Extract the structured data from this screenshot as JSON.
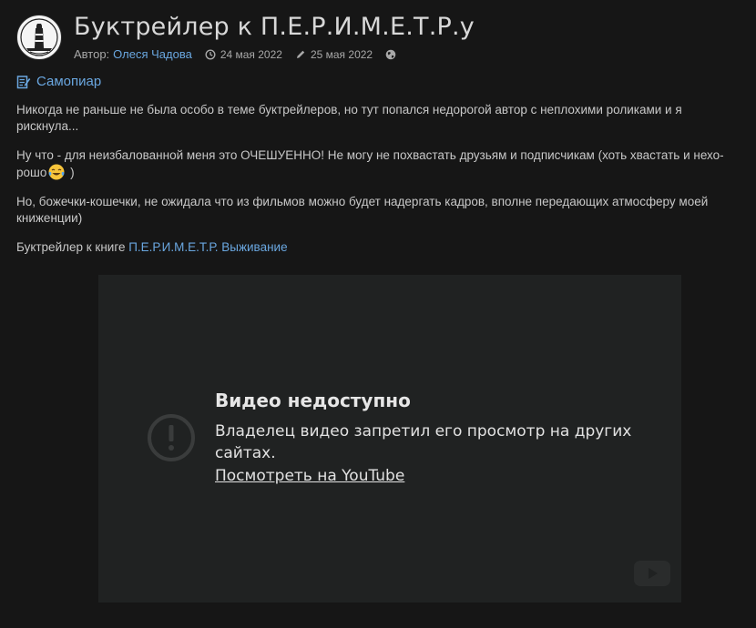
{
  "header": {
    "title": "Буктрейлер к П.Е.Р.И.М.Е.Т.Р.у",
    "author_label": "Автор:",
    "author_name": "Олеся Чадова",
    "created_date": "24 мая 2022",
    "edited_date": "25 мая 2022",
    "icons": {
      "created": "clock-icon",
      "edited": "pencil-icon",
      "visibility": "globe-icon"
    }
  },
  "category": {
    "label": "Самопиар",
    "icon": "note-icon"
  },
  "content": {
    "p1": "Никогда не раньше не была особо в теме буктрейлеров, но тут попался недорогой автор с неплохими роликами и я рискнула...",
    "p2_text": "Ну что - для неизбалованной меня это ОЧЕШУЕННО! Не могу не похвастать друзьям и подписчикам (хоть хвастать и нехо-рошо",
    "p2_tail": " )",
    "p3": "Но, божечки-кошечки, не ожидала что из фильмов можно будет надергать кадров, вполне передающих атмосферу моей книженции)",
    "p4_text": "Буктрейлер к книге ",
    "p4_link": "П.Е.Р.И.М.Е.Т.Р. Выживание"
  },
  "video": {
    "title": "Видео недоступно",
    "message": "Владелец видео запретил его просмотр на других сайтах.",
    "link": "Посмотреть на YouTube"
  },
  "colors": {
    "background": "#161616",
    "link": "#6aa7e0",
    "video_bg": "#202222"
  }
}
